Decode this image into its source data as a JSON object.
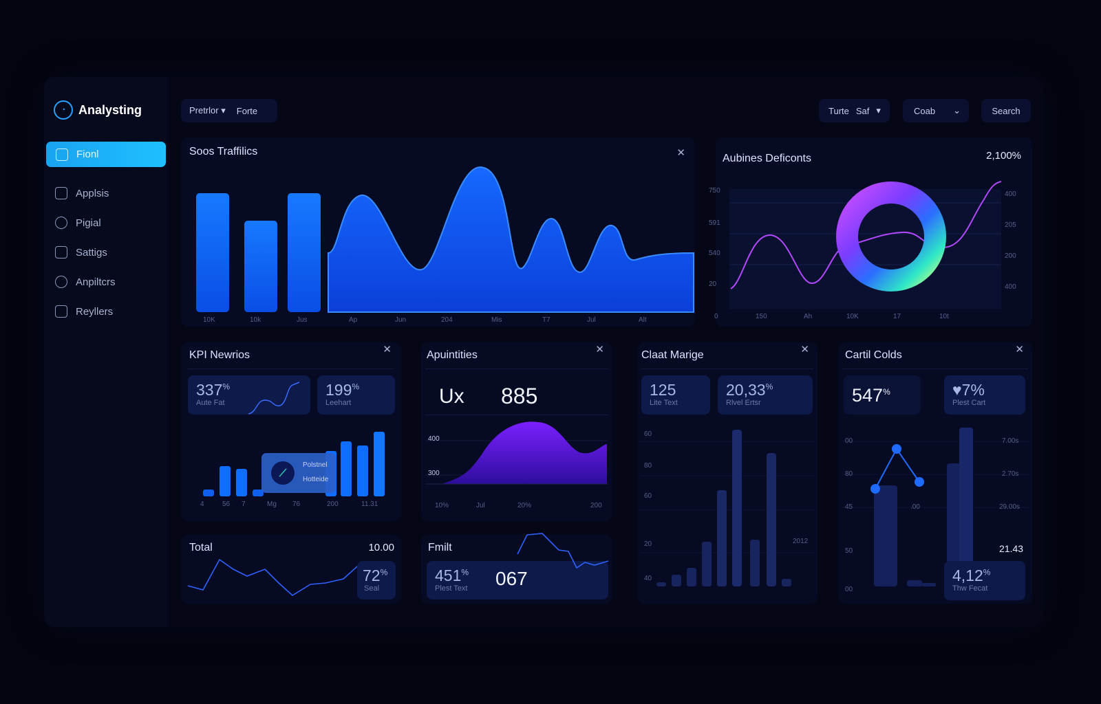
{
  "app": {
    "brand": "Analysting"
  },
  "sidebar": {
    "items": [
      {
        "label": "Fionl",
        "icon": "home-icon"
      },
      {
        "label": "Applsis",
        "icon": "clipboard-icon"
      },
      {
        "label": "Pigial",
        "icon": "globe-icon"
      },
      {
        "label": "Sattigs",
        "icon": "settings-icon"
      },
      {
        "label": "Anpiltcrs",
        "icon": "users-icon"
      },
      {
        "label": "Reyllers",
        "icon": "stack-icon"
      }
    ]
  },
  "toolbar": {
    "filter1": "Pretrlor",
    "filter2": "Forte",
    "right_pill_a": "Turte",
    "right_pill_b": "Saf",
    "combo": "Coab",
    "search": "Search"
  },
  "colors": {
    "accent": "#1aa3f0",
    "bar_blue": "#0f6dff",
    "area_blue": "#1453ff",
    "violet": "#7a1fff",
    "card_bg": "#060a22",
    "kpi_bg": "#0d1a4a"
  },
  "cards": {
    "traffic": {
      "title": "Soos Traffilics",
      "xticks": [
        "10K",
        "10k",
        "Jus",
        "Ap",
        "Jun",
        "204",
        "Mis",
        "T7",
        "Jul",
        "Alt"
      ]
    },
    "donut": {
      "title": "Aubines Deficonts",
      "value": "2,100%",
      "left_ticks": [
        "750",
        "591",
        "540",
        "20"
      ],
      "right_ticks": [
        "400",
        "205",
        "200",
        "400"
      ],
      "xticks": [
        "0",
        "150",
        "Ah",
        "10K",
        "17",
        "10t"
      ]
    },
    "kpi_newrios": {
      "title": "KPI Newrios",
      "kpi1": {
        "value": "337",
        "unit": "%",
        "label": "Aute Fat"
      },
      "kpi2": {
        "value": "199",
        "unit": "%",
        "label": "Leehart"
      },
      "tooltip_line1": "Polstnel",
      "tooltip_line2": "Hotteide",
      "xticks": [
        "4",
        "56",
        "7",
        "Mg",
        "76",
        "200",
        "11.31"
      ]
    },
    "apuntities": {
      "title": "Apuintities",
      "label": "Ux",
      "value": "885",
      "yticks": [
        "400",
        "300"
      ],
      "xticks": [
        "10%",
        "Jul",
        "20%",
        "200"
      ]
    },
    "chat_marge": {
      "title": "Claat Marige",
      "kpi1": {
        "value": "125",
        "label": "Lite Text"
      },
      "kpi2": {
        "value": "20,33",
        "unit": "%",
        "label": "Rlvel Ertsr"
      },
      "yticks": [
        "60",
        "80",
        "60",
        "20",
        "40"
      ],
      "annotation": "2012"
    },
    "cartil": {
      "title": "Cartil Colds",
      "kpi1": {
        "value": "547",
        "unit": "%"
      },
      "kpi2": {
        "value": "7%",
        "label": "Plest Cart"
      },
      "left_ticks": [
        "00",
        "80",
        "45",
        "50",
        "00"
      ],
      "right_ticks": [
        "7.00s",
        "2.70s",
        "29.00s"
      ],
      "mid_tick": ".00",
      "total": "21.43",
      "kpi3": {
        "value": "4,12",
        "unit": "%",
        "label": "Thw Fecat"
      }
    },
    "total": {
      "title": "Total",
      "value": "10.00",
      "kpi": {
        "value": "72",
        "unit": "%",
        "label": "Seal"
      }
    },
    "fruit": {
      "title": "Fmilt",
      "kpi": {
        "value": "451",
        "unit": "%",
        "label": "Plest Text"
      },
      "value": "067"
    }
  }
}
